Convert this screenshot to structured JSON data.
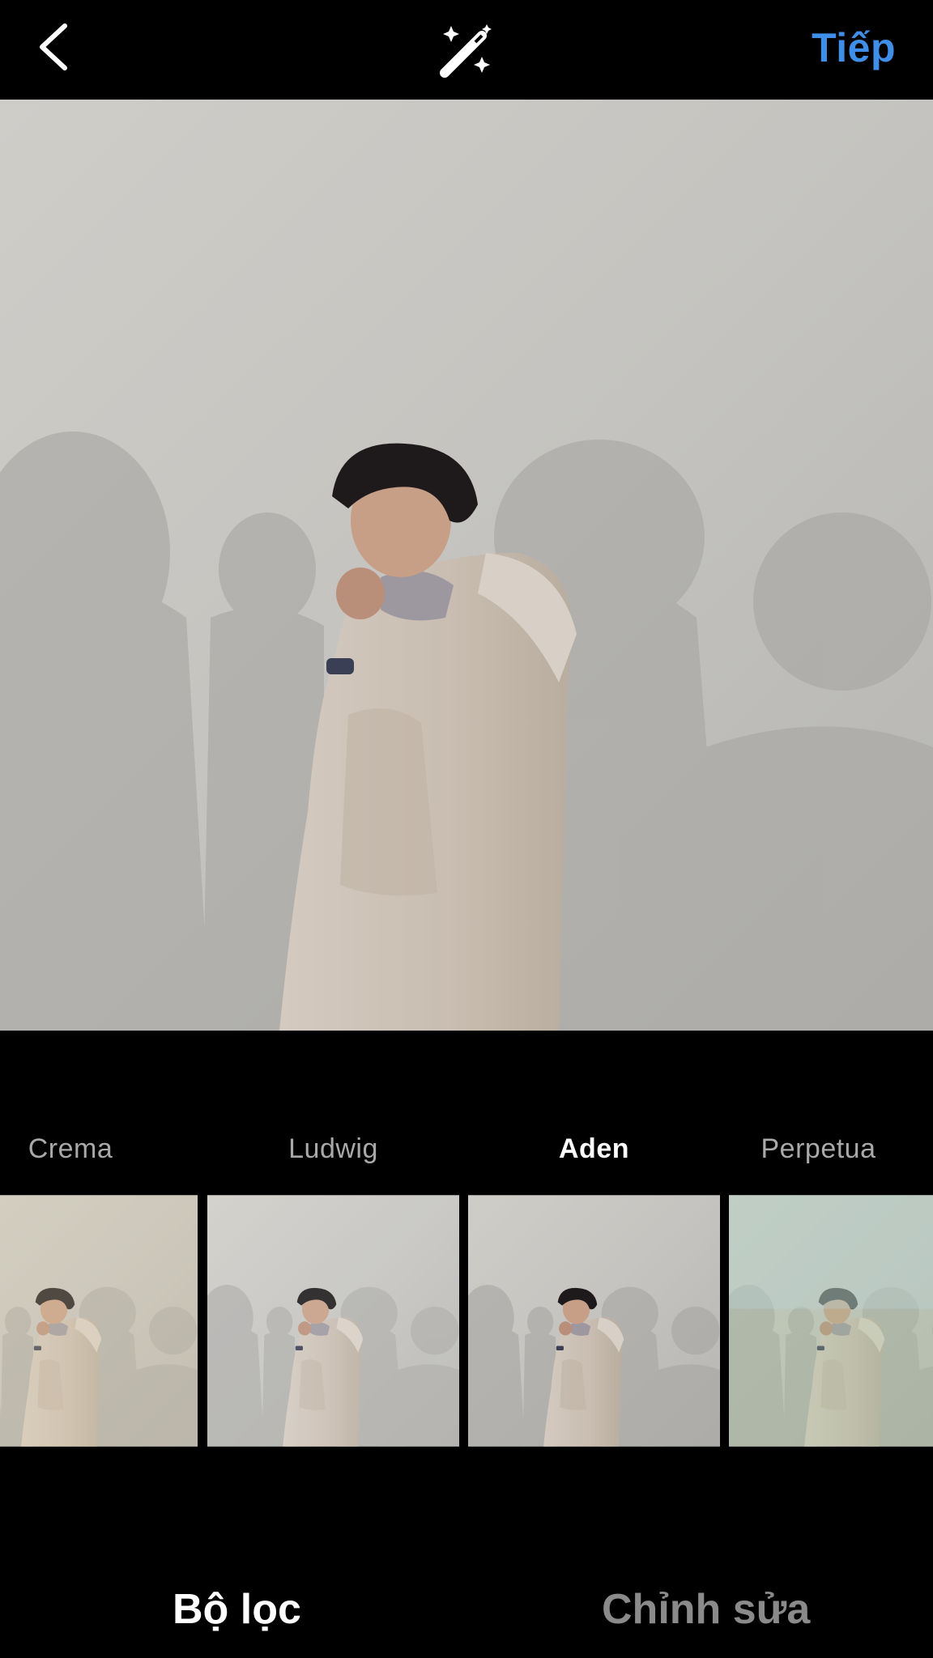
{
  "header": {
    "back_icon": "chevron-left-icon",
    "magic_icon": "magic-wand-icon",
    "next_label": "Tiếp",
    "accent_color": "#3f8ee8"
  },
  "filters": [
    {
      "label": "Crema",
      "selected": false
    },
    {
      "label": "Ludwig",
      "selected": false
    },
    {
      "label": "Aden",
      "selected": true
    },
    {
      "label": "Perpetua",
      "selected": false
    }
  ],
  "tabs": {
    "filter_label": "Bộ lọc",
    "edit_label": "Chỉnh sửa"
  }
}
